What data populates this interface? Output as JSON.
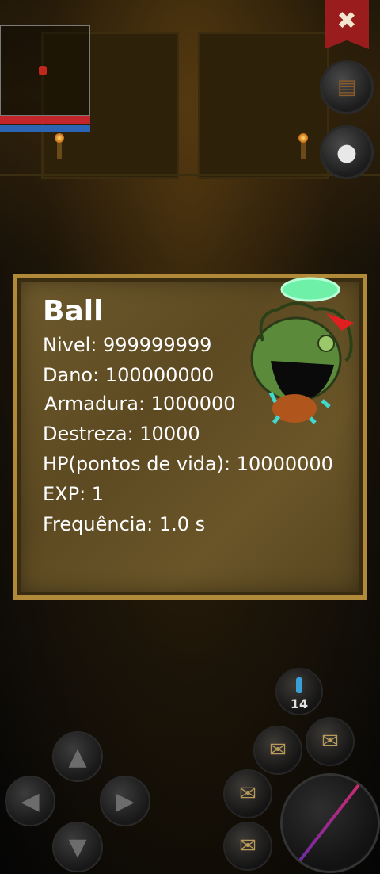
{
  "hud": {
    "hp_fraction": 1.0,
    "mp_fraction": 1.0,
    "menu_icon": "crossed-tools-icon",
    "bag_icon": "bag-icon",
    "chat_icon": "chat-bubble-icon"
  },
  "monster": {
    "name": "Ball",
    "stats": [
      "Nivel: 999999999",
      "Dano: 100000000",
      "Armadura: 1000000",
      "Destreza: 10000",
      "HP(pontos de vida): 10000000",
      "EXP: 1",
      "Frequência: 1.0 s"
    ]
  },
  "controls": {
    "dpad_up": "▲",
    "dpad_down": "▼",
    "dpad_left": "◀",
    "dpad_right": "▶",
    "potion_count": "14",
    "skill_icon": "scroll-icon"
  },
  "colors": {
    "panel_border": "#b08a38",
    "panel_fill": "#6e5a2c",
    "hp": "#c3262a",
    "mp": "#2c64b4",
    "banner": "#9a1c1c"
  }
}
